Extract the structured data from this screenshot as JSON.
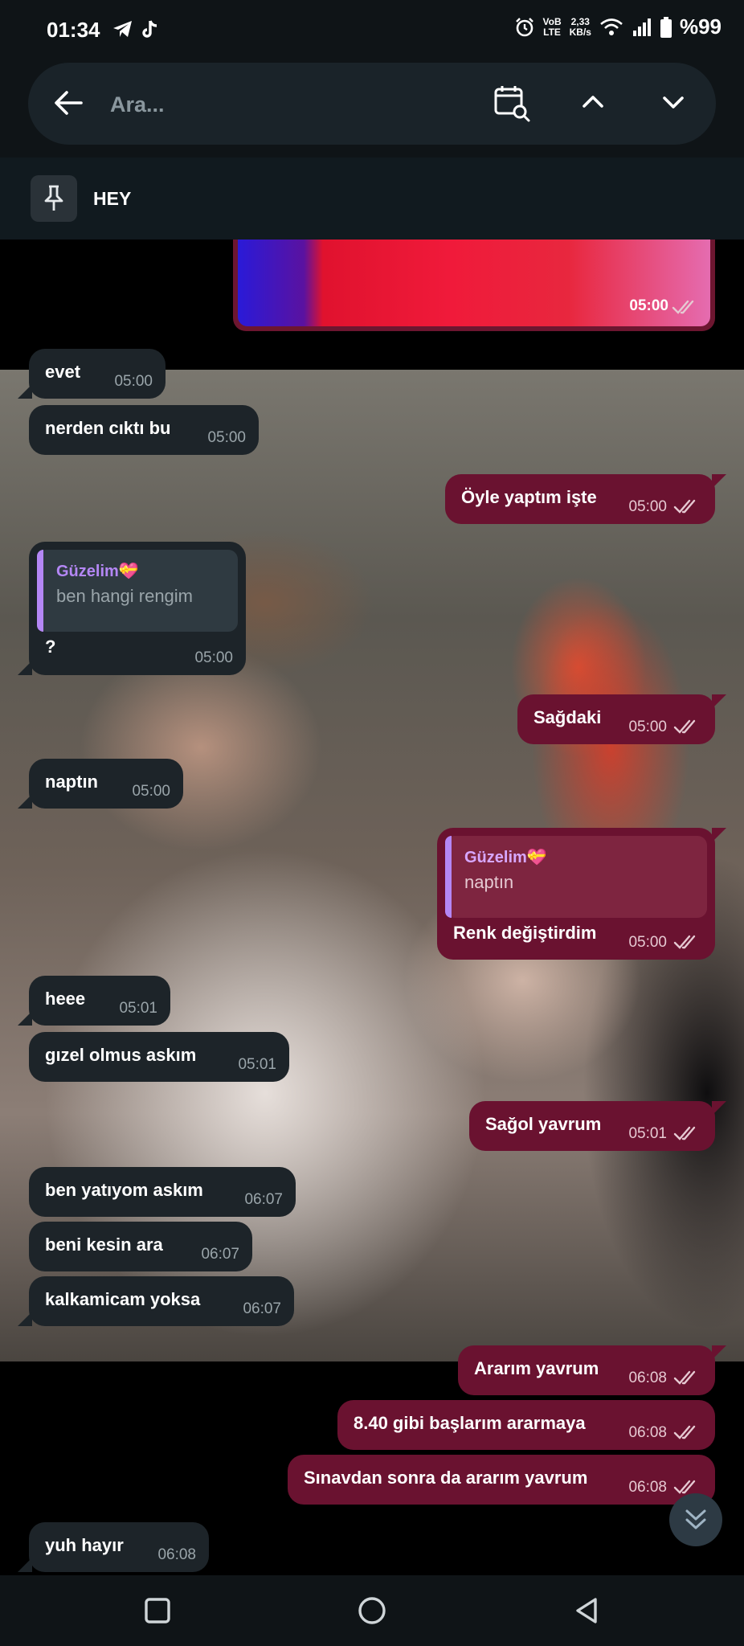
{
  "status_bar": {
    "time": "01:34",
    "volte_line1": "VoB",
    "volte_line2": "LTE",
    "speed_value": "2,33",
    "speed_unit": "KB/s",
    "battery": "%99"
  },
  "search": {
    "placeholder": "Ara..."
  },
  "pinned": {
    "text": "HEY"
  },
  "media": {
    "time": "05:00"
  },
  "messages": [
    {
      "side": "in",
      "text": "evet",
      "time": "05:00"
    },
    {
      "side": "in",
      "text": "nerden cıktı bu",
      "time": "05:00"
    },
    {
      "side": "out",
      "text": "Öyle yaptım işte",
      "time": "05:00"
    },
    {
      "side": "in",
      "text": "?",
      "time": "05:00",
      "reply": {
        "name": "Güzelim💝",
        "text": "ben hangi rengim"
      }
    },
    {
      "side": "out",
      "text": "Sağdaki",
      "time": "05:00"
    },
    {
      "side": "in",
      "text": "naptın",
      "time": "05:00"
    },
    {
      "side": "out",
      "text": "Renk değiştirdim",
      "time": "05:00",
      "reply": {
        "name": "Güzelim💝",
        "text": "naptın"
      }
    },
    {
      "side": "in",
      "text": "heee",
      "time": "05:01"
    },
    {
      "side": "in",
      "text": "gızel olmus askım",
      "time": "05:01"
    },
    {
      "side": "out",
      "text": "Sağol yavrum",
      "time": "05:01"
    },
    {
      "side": "in",
      "text": "ben yatıyom askım",
      "time": "06:07"
    },
    {
      "side": "in",
      "text": "beni kesin ara",
      "time": "06:07"
    },
    {
      "side": "in",
      "text": "kalkamicam yoksa",
      "time": "06:07"
    },
    {
      "side": "out",
      "text": "Ararım yavrum",
      "time": "06:08"
    },
    {
      "side": "out",
      "text": "8.40 gibi başlarım ararmaya",
      "time": "06:08"
    },
    {
      "side": "out",
      "text": "Sınavdan sonra da ararım yavrum",
      "time": "06:08"
    },
    {
      "side": "in",
      "text": "yuh hayır",
      "time": "06:08"
    }
  ],
  "colors": {
    "incoming_bubble": "#1d2429",
    "outgoing_bubble": "#6a1230",
    "reply_accent": "#b487f5",
    "header_bg": "#0f1417"
  },
  "icons": [
    "back-arrow-icon",
    "calendar-search-icon",
    "chevron-up-icon",
    "chevron-down-icon",
    "pin-icon",
    "double-check-icon",
    "scroll-down-icon",
    "square-icon",
    "circle-icon",
    "triangle-back-icon"
  ]
}
